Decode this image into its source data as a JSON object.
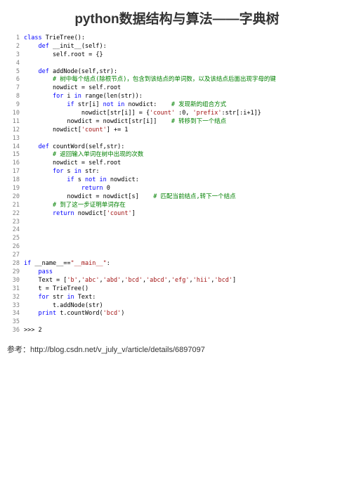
{
  "title": "python数据结构与算法——字典树",
  "code": {
    "lines": [
      {
        "n": 1,
        "tokens": [
          [
            "kw",
            "class"
          ],
          [
            "",
            " TrieTree():"
          ]
        ]
      },
      {
        "n": 2,
        "tokens": [
          [
            "",
            "    "
          ],
          [
            "kw",
            "def"
          ],
          [
            "",
            " __init__(self):"
          ]
        ]
      },
      {
        "n": 3,
        "tokens": [
          [
            "",
            "        self.root = {}"
          ]
        ]
      },
      {
        "n": 4,
        "tokens": []
      },
      {
        "n": 5,
        "tokens": [
          [
            "",
            "    "
          ],
          [
            "kw",
            "def"
          ],
          [
            "",
            " addNode(self,str):"
          ]
        ]
      },
      {
        "n": 6,
        "tokens": [
          [
            "",
            "        "
          ],
          [
            "comment",
            "# 树中每个结点(除根节点)，包含到该结点的单词数，以及该结点后面出现字母的键"
          ]
        ]
      },
      {
        "n": 7,
        "tokens": [
          [
            "",
            "        nowdict = self.root"
          ]
        ]
      },
      {
        "n": 8,
        "tokens": [
          [
            "",
            "        "
          ],
          [
            "kw",
            "for"
          ],
          [
            "",
            " i "
          ],
          [
            "kw",
            "in"
          ],
          [
            "",
            " range(len(str)):"
          ]
        ]
      },
      {
        "n": 9,
        "tokens": [
          [
            "",
            "            "
          ],
          [
            "kw",
            "if"
          ],
          [
            "",
            " str[i] "
          ],
          [
            "kw",
            "not"
          ],
          [
            "",
            " "
          ],
          [
            "kw",
            "in"
          ],
          [
            "",
            " nowdict:    "
          ],
          [
            "comment",
            "# 发现新的组合方式"
          ]
        ]
      },
      {
        "n": 10,
        "tokens": [
          [
            "",
            "                nowdict[str[i]] = {"
          ],
          [
            "str",
            "'count'"
          ],
          [
            "",
            " :0, "
          ],
          [
            "str",
            "'prefix'"
          ],
          [
            "",
            ":str[:i+1]}"
          ]
        ]
      },
      {
        "n": 11,
        "tokens": [
          [
            "",
            "            nowdict = nowdict[str[i]]    "
          ],
          [
            "comment",
            "# 转移到下一个结点"
          ]
        ]
      },
      {
        "n": 12,
        "tokens": [
          [
            "",
            "        nowdict["
          ],
          [
            "str",
            "'count'"
          ],
          [
            "",
            "] += 1"
          ]
        ]
      },
      {
        "n": 13,
        "tokens": []
      },
      {
        "n": 14,
        "tokens": [
          [
            "",
            "    "
          ],
          [
            "kw",
            "def"
          ],
          [
            "",
            " countWord(self,str):"
          ]
        ]
      },
      {
        "n": 15,
        "tokens": [
          [
            "",
            "        "
          ],
          [
            "comment",
            "# 返回输入单词在树中出现的次数"
          ]
        ]
      },
      {
        "n": 16,
        "tokens": [
          [
            "",
            "        nowdict = self.root"
          ]
        ]
      },
      {
        "n": 17,
        "tokens": [
          [
            "",
            "        "
          ],
          [
            "kw",
            "for"
          ],
          [
            "",
            " s "
          ],
          [
            "kw",
            "in"
          ],
          [
            "",
            " str:"
          ]
        ]
      },
      {
        "n": 18,
        "tokens": [
          [
            "",
            "            "
          ],
          [
            "kw",
            "if"
          ],
          [
            "",
            " s "
          ],
          [
            "kw",
            "not"
          ],
          [
            "",
            " "
          ],
          [
            "kw",
            "in"
          ],
          [
            "",
            " nowdict:"
          ]
        ]
      },
      {
        "n": 19,
        "tokens": [
          [
            "",
            "                "
          ],
          [
            "kw",
            "return"
          ],
          [
            "",
            " 0"
          ]
        ]
      },
      {
        "n": 20,
        "tokens": [
          [
            "",
            "            nowdict = nowdict[s]    "
          ],
          [
            "comment",
            "# 匹配当前结点,转下一个结点"
          ]
        ]
      },
      {
        "n": 21,
        "tokens": [
          [
            "",
            "        "
          ],
          [
            "comment",
            "# 到了这一步证明单词存在"
          ]
        ]
      },
      {
        "n": 22,
        "tokens": [
          [
            "",
            "        "
          ],
          [
            "kw",
            "return"
          ],
          [
            "",
            " nowdict["
          ],
          [
            "str",
            "'count'"
          ],
          [
            "",
            "]"
          ]
        ]
      },
      {
        "n": 23,
        "tokens": []
      },
      {
        "n": 24,
        "tokens": []
      },
      {
        "n": 25,
        "tokens": []
      },
      {
        "n": 26,
        "tokens": []
      },
      {
        "n": 27,
        "tokens": []
      },
      {
        "n": 28,
        "tokens": [
          [
            "kw",
            "if"
          ],
          [
            "",
            " __name__=="
          ],
          [
            "str",
            "\"__main__\""
          ],
          [
            "",
            ":"
          ]
        ]
      },
      {
        "n": 29,
        "tokens": [
          [
            "",
            "    "
          ],
          [
            "kw",
            "pass"
          ]
        ]
      },
      {
        "n": 30,
        "tokens": [
          [
            "",
            "    Text = ["
          ],
          [
            "str",
            "'b'"
          ],
          [
            "",
            ","
          ],
          [
            "str",
            "'abc'"
          ],
          [
            "",
            ","
          ],
          [
            "str",
            "'abd'"
          ],
          [
            "",
            ","
          ],
          [
            "str",
            "'bcd'"
          ],
          [
            "",
            ","
          ],
          [
            "str",
            "'abcd'"
          ],
          [
            "",
            ","
          ],
          [
            "str",
            "'efg'"
          ],
          [
            "",
            ","
          ],
          [
            "str",
            "'hii'"
          ],
          [
            "",
            ","
          ],
          [
            "str",
            "'bcd'"
          ],
          [
            "",
            "]"
          ]
        ]
      },
      {
        "n": 31,
        "tokens": [
          [
            "",
            "    t = TrieTree()"
          ]
        ]
      },
      {
        "n": 32,
        "tokens": [
          [
            "",
            "    "
          ],
          [
            "kw",
            "for"
          ],
          [
            "",
            " str "
          ],
          [
            "kw",
            "in"
          ],
          [
            "",
            " Text:"
          ]
        ]
      },
      {
        "n": 33,
        "tokens": [
          [
            "",
            "        t.addNode(str)"
          ]
        ]
      },
      {
        "n": 34,
        "tokens": [
          [
            "",
            "    "
          ],
          [
            "kw",
            "print"
          ],
          [
            "",
            " t.countWord("
          ],
          [
            "str",
            "'bcd'"
          ],
          [
            "",
            ")"
          ]
        ]
      },
      {
        "n": 35,
        "tokens": []
      },
      {
        "n": 36,
        "tokens": [
          [
            "",
            ">>> 2"
          ]
        ]
      }
    ]
  },
  "reference": "参考：http://blog.csdn.net/v_july_v/article/details/6897097"
}
